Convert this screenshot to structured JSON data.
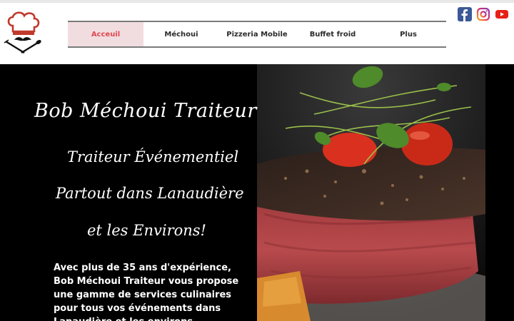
{
  "header": {
    "nav": [
      {
        "label": "Acceuil",
        "active": true
      },
      {
        "label": "Méchoui",
        "active": false
      },
      {
        "label": "Pizzeria Mobile",
        "active": false
      },
      {
        "label": "Buffet froid",
        "active": false
      },
      {
        "label": "Plus",
        "active": false
      }
    ],
    "social": [
      "facebook-icon",
      "instagram-icon",
      "youtube-icon"
    ]
  },
  "hero": {
    "title": "Bob Méchoui Traiteur",
    "subtitle_1": "Traiteur Événementiel",
    "subtitle_2": "Partout dans Lanaudière",
    "subtitle_3": "et les Environs!",
    "description": "Avec plus de 35 ans d'expérience, Bob Méchoui Traiteur vous propose une gamme de services culinaires pour tous vos événements dans Lanaudière et les environs."
  },
  "colors": {
    "active_nav_bg": "#f1dde0",
    "active_nav_text": "#e0474f",
    "hero_bg": "#000000",
    "logo_red": "#c0392b"
  }
}
